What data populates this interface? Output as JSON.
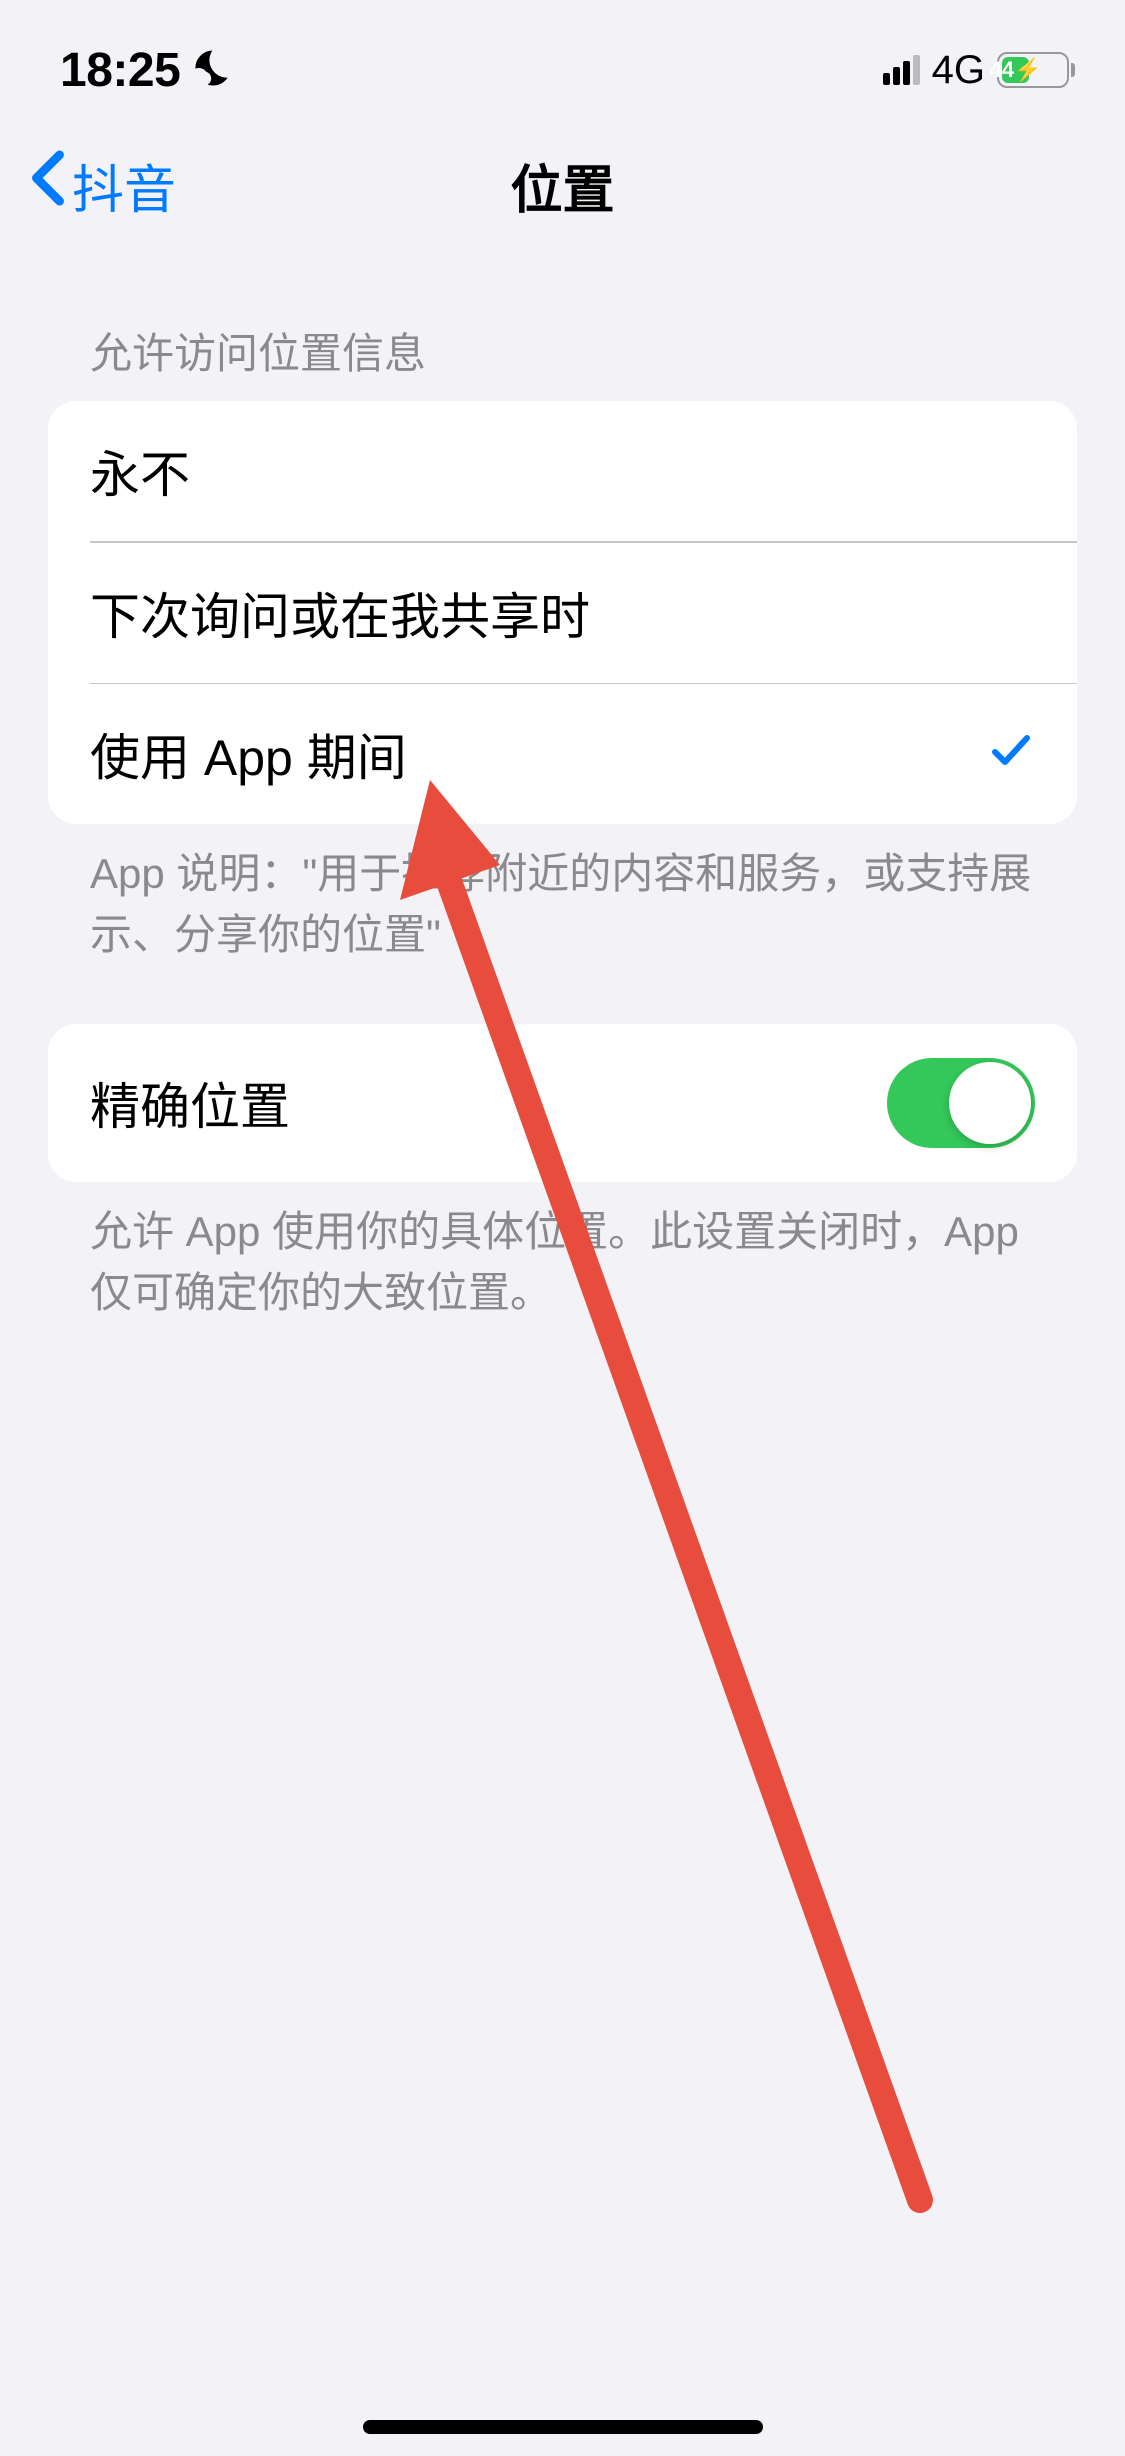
{
  "statusBar": {
    "time": "18:25",
    "networkType": "4G",
    "batteryPercent": "44"
  },
  "nav": {
    "backLabel": "抖音",
    "title": "位置"
  },
  "locationSection": {
    "header": "允许访问位置信息",
    "options": [
      {
        "label": "永不",
        "selected": false
      },
      {
        "label": "下次询问或在我共享时",
        "selected": false
      },
      {
        "label": "使用 App 期间",
        "selected": true
      }
    ],
    "footer": "App 说明：\"用于推荐附近的内容和服务，或支持展示、分享你的位置\""
  },
  "preciseSection": {
    "label": "精确位置",
    "enabled": true,
    "footer": "允许 App 使用你的具体位置。此设置关闭时，App 仅可确定你的大致位置。"
  },
  "annotation": {
    "color": "#e74c3c"
  }
}
